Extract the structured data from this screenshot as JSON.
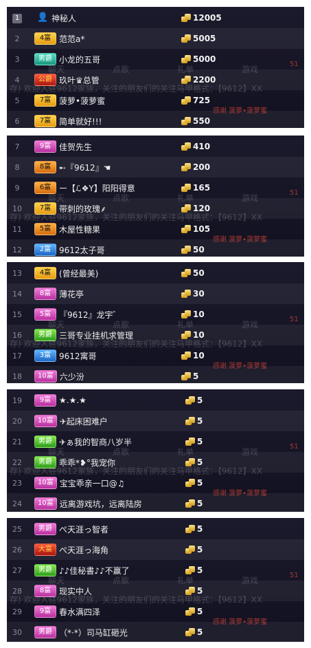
{
  "overlay": {
    "tabs": [
      "聊天",
      "点歌",
      "礼单",
      "游戏"
    ],
    "notice": "存) 欢迎入驻9612家族，关注的朋友们的关注马甲格式：【9612】XX",
    "thanks": "感谢 菠萝•菠萝蜜",
    "badge_num": "51"
  },
  "panels": [
    {
      "rows": [
        {
          "rank": "1",
          "top": true,
          "badge": "",
          "badge_color": "",
          "avatar": "person-icon",
          "name": "神秘人",
          "score": "12005"
        },
        {
          "rank": "2",
          "badge": "4富",
          "badge_color": "yellow",
          "name": "范范a*",
          "score": "5005"
        },
        {
          "rank": "3",
          "badge": "男爵",
          "badge_color": "teal",
          "name": "小龙的五哥",
          "score": "5000"
        },
        {
          "rank": "4",
          "badge": "公爵",
          "badge_color": "red",
          "name": "玖叶♛总管",
          "score": "2200"
        },
        {
          "rank": "5",
          "badge": "7富",
          "badge_color": "yellow",
          "name": "菠萝•菠萝蜜",
          "score": "725"
        },
        {
          "rank": "6",
          "badge": "7富",
          "badge_color": "yellow",
          "name": "简单就好!!!",
          "score": "550"
        }
      ]
    },
    {
      "rows": [
        {
          "rank": "7",
          "badge": "9富",
          "badge_color": "pink",
          "name": "佳贺先生",
          "score": "410"
        },
        {
          "rank": "8",
          "badge": "8富",
          "badge_color": "orange",
          "name": "➸『9612』☚",
          "score": "200"
        },
        {
          "rank": "9",
          "badge": "6富",
          "badge_color": "orange",
          "name": "ー【ℒ❖Y】阳阳得意",
          "score": "165"
        },
        {
          "rank": "10",
          "badge": "7富",
          "badge_color": "yellow",
          "name": "带刺的玫瑰⸙",
          "score": "120"
        },
        {
          "rank": "11",
          "badge": "5富",
          "badge_color": "orange",
          "name": "木屋性糖果",
          "score": "105"
        },
        {
          "rank": "12",
          "badge": "2富",
          "badge_color": "blue",
          "name": "9612太子哥",
          "score": "50"
        }
      ]
    },
    {
      "rows": [
        {
          "rank": "13",
          "badge": "4富",
          "badge_color": "yellow",
          "name": "(曾经最美)",
          "score": "50"
        },
        {
          "rank": "14",
          "badge": "8富",
          "badge_color": "pink",
          "name": "薄花亭",
          "score": "30"
        },
        {
          "rank": "15",
          "badge": "5富",
          "badge_color": "pink",
          "name": "『9612』龙宇゛",
          "score": "10"
        },
        {
          "rank": "16",
          "badge": "男爵",
          "badge_color": "green",
          "name": "三哥专业挂机求管理",
          "score": "10"
        },
        {
          "rank": "17",
          "badge": "3富",
          "badge_color": "blue",
          "name": "9612寓哥",
          "score": "10"
        },
        {
          "rank": "18",
          "badge": "10富",
          "badge_color": "pink",
          "name": "六少汾",
          "score": "5"
        }
      ]
    },
    {
      "rows": [
        {
          "rank": "19",
          "badge": "9富",
          "badge_color": "pink",
          "name": "★.★.★",
          "score": "5"
        },
        {
          "rank": "20",
          "badge": "10富",
          "badge_color": "pink",
          "name": "✈起床困难户",
          "score": "5"
        },
        {
          "rank": "21",
          "badge": "男爵",
          "badge_color": "green",
          "name": "✈ぁ我的智商八岁半",
          "score": "5"
        },
        {
          "rank": "22",
          "badge": "男爵",
          "badge_color": "green",
          "name": "乖乖*❥°我宠你",
          "score": "5"
        },
        {
          "rank": "23",
          "badge": "10富",
          "badge_color": "pink",
          "name": "宝宝乖亲一口@♫",
          "score": "5"
        },
        {
          "rank": "24",
          "badge": "10富",
          "badge_color": "pink",
          "name": "远离游戏坑，远离陆房",
          "score": "5"
        }
      ]
    },
    {
      "rows": [
        {
          "rank": "25",
          "badge": "男爵",
          "badge_color": "pink",
          "name": "ぺ天涯っ智者",
          "score": "5"
        },
        {
          "rank": "26",
          "badge": "大富",
          "badge_color": "red",
          "name": "ぺ天涯っ海角",
          "score": "5"
        },
        {
          "rank": "27",
          "badge": "男爵",
          "badge_color": "green",
          "name": "♪♪佳秘書♪♪不赢了",
          "score": "5"
        },
        {
          "rank": "28",
          "badge": "8富",
          "badge_color": "pink",
          "name": "现实中人",
          "score": "5"
        },
        {
          "rank": "29",
          "badge": "9富",
          "badge_color": "pink",
          "name": "春水满四泽",
          "score": "5"
        },
        {
          "rank": "30",
          "badge": "男爵",
          "badge_color": "pink",
          "name": "（*·*）司马缸砸光",
          "score": "5"
        }
      ]
    }
  ]
}
